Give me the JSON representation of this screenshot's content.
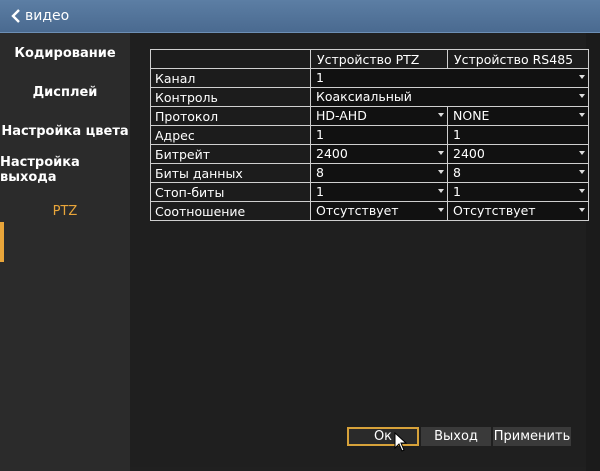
{
  "header": {
    "back_label": "видео"
  },
  "sidebar": {
    "items": [
      {
        "label": "Кодирование"
      },
      {
        "label": "Дисплей"
      },
      {
        "label": "Настройка цвета"
      },
      {
        "label": "Настройка выхода"
      },
      {
        "label": "PTZ"
      }
    ],
    "active_index": 4
  },
  "table": {
    "col_headers": [
      "Устройство PTZ",
      "Устройство RS485"
    ],
    "rows": [
      {
        "label": "Канал",
        "values": [
          "1"
        ]
      },
      {
        "label": "Контроль",
        "values": [
          "Коаксиальный"
        ]
      },
      {
        "label": "Протокол",
        "values": [
          "HD-AHD",
          "NONE"
        ]
      },
      {
        "label": "Адрес",
        "values": [
          "1",
          "1"
        ]
      },
      {
        "label": "Битрейт",
        "values": [
          "2400",
          "2400"
        ]
      },
      {
        "label": "Биты данных",
        "values": [
          "8",
          "8"
        ]
      },
      {
        "label": "Стоп-биты",
        "values": [
          "1",
          "1"
        ]
      },
      {
        "label": "Соотношение",
        "values": [
          "Отсутствует",
          "Отсутствует"
        ]
      }
    ]
  },
  "buttons": {
    "ok": "Ок",
    "exit": "Выход",
    "apply": "Применить"
  },
  "colors": {
    "accent": "#e8a53a",
    "titlebar": "#5577a0"
  }
}
